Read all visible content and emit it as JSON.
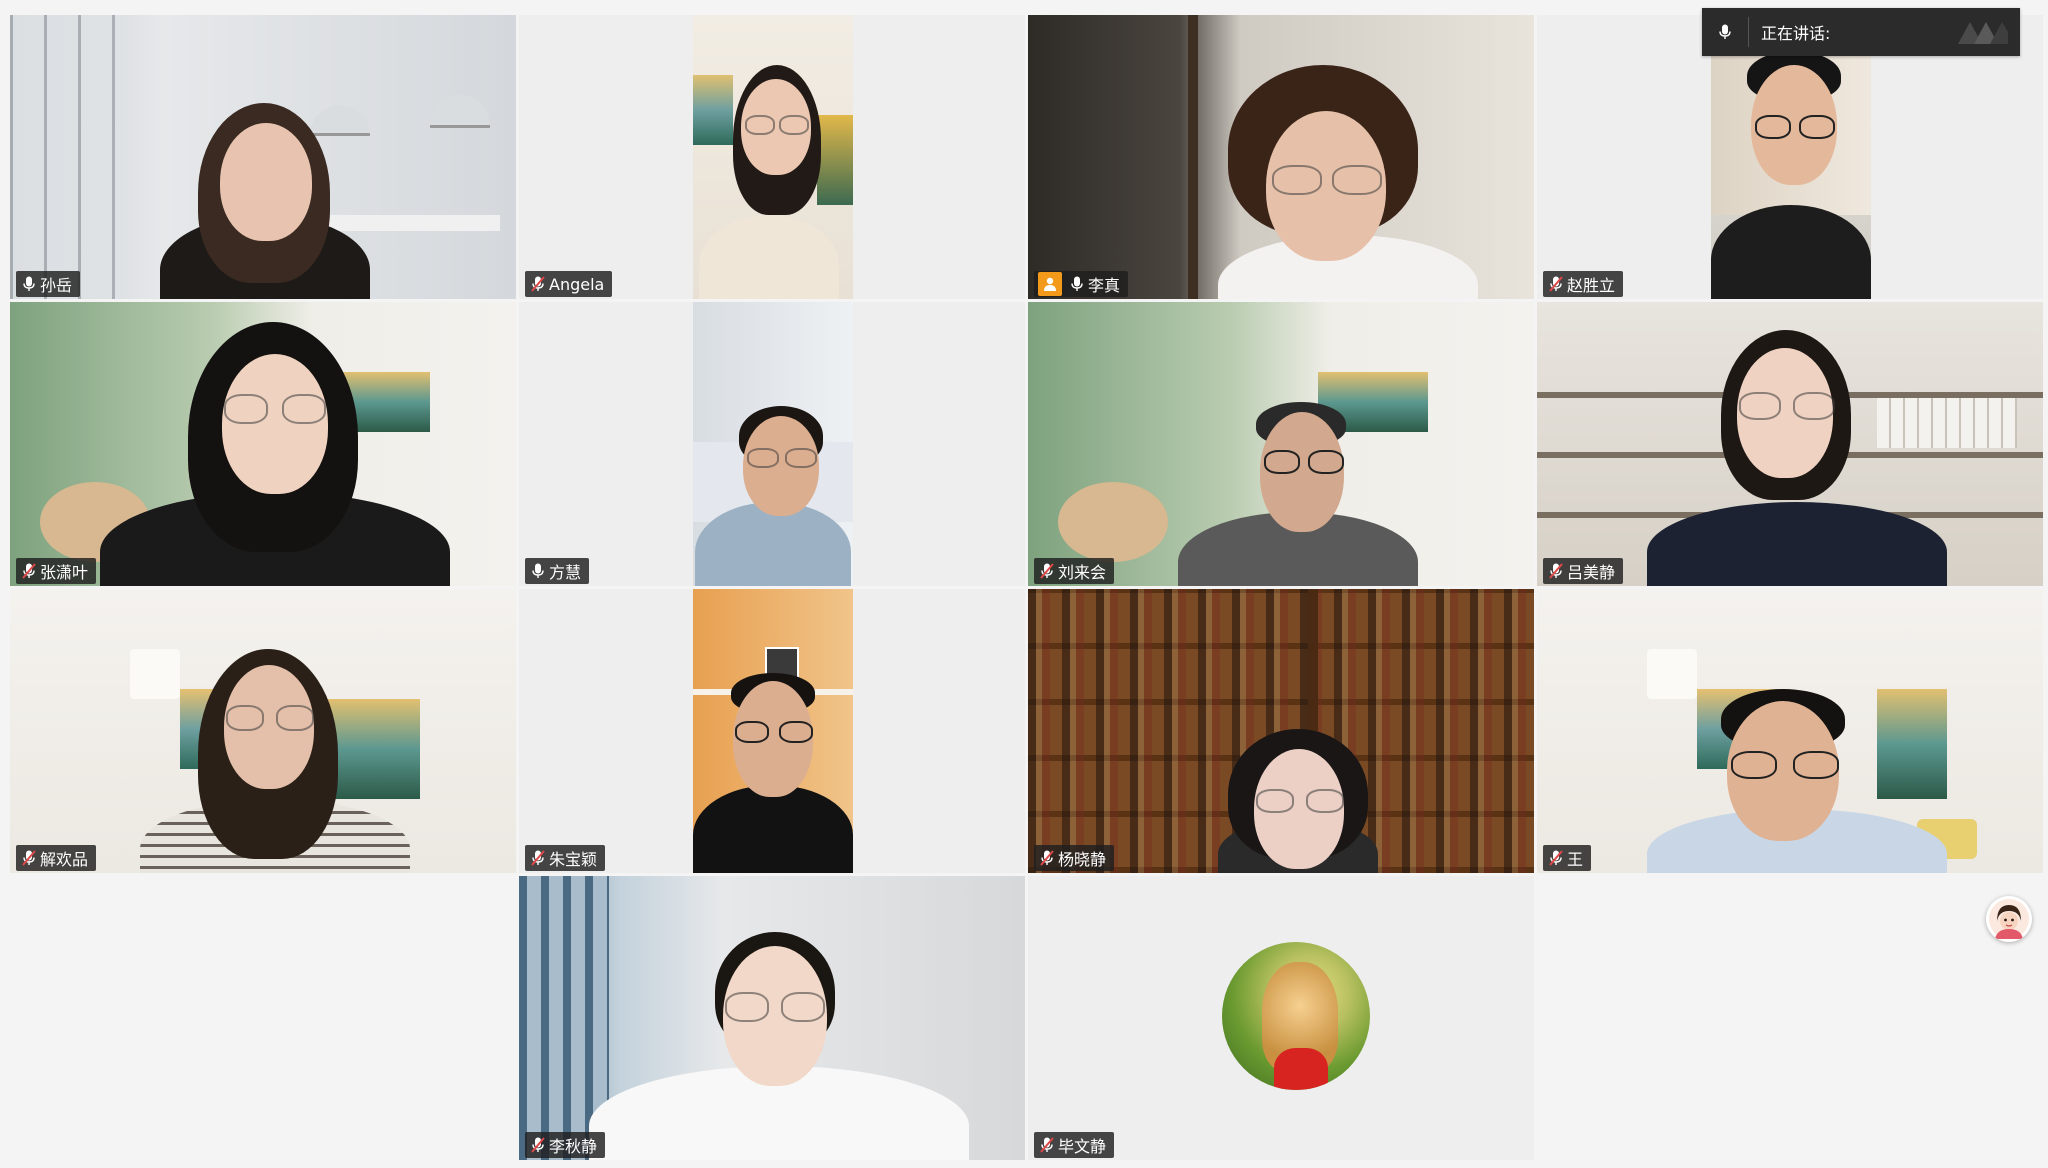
{
  "speaking_indicator": {
    "label": "正在讲话:"
  },
  "participants": [
    {
      "name": "孙岳",
      "muted": false
    },
    {
      "name": "Angela",
      "muted": true
    },
    {
      "name": "李真",
      "muted": false,
      "host": true
    },
    {
      "name": "赵胜立",
      "muted": true
    },
    {
      "name": "张潇叶",
      "muted": true
    },
    {
      "name": "方慧",
      "muted": false
    },
    {
      "name": "刘来会",
      "muted": true
    },
    {
      "name": "吕美静",
      "muted": true
    },
    {
      "name": "解欢品",
      "muted": true
    },
    {
      "name": "朱宝颖",
      "muted": true
    },
    {
      "name": "杨晓静",
      "muted": true
    },
    {
      "name": "王",
      "muted": true
    },
    {
      "name": "李秋静",
      "muted": true
    },
    {
      "name": "毕文静",
      "muted": true,
      "video_off": true
    }
  ],
  "icons": {
    "mic": "microphone-icon",
    "mic_muted": "microphone-muted-icon",
    "host": "host-badge-icon",
    "expand": "expand-icon"
  },
  "colors": {
    "nametag_bg": "#1e1e1e",
    "host_badge": "#f39a1a",
    "muted_mic": "#e04848"
  }
}
